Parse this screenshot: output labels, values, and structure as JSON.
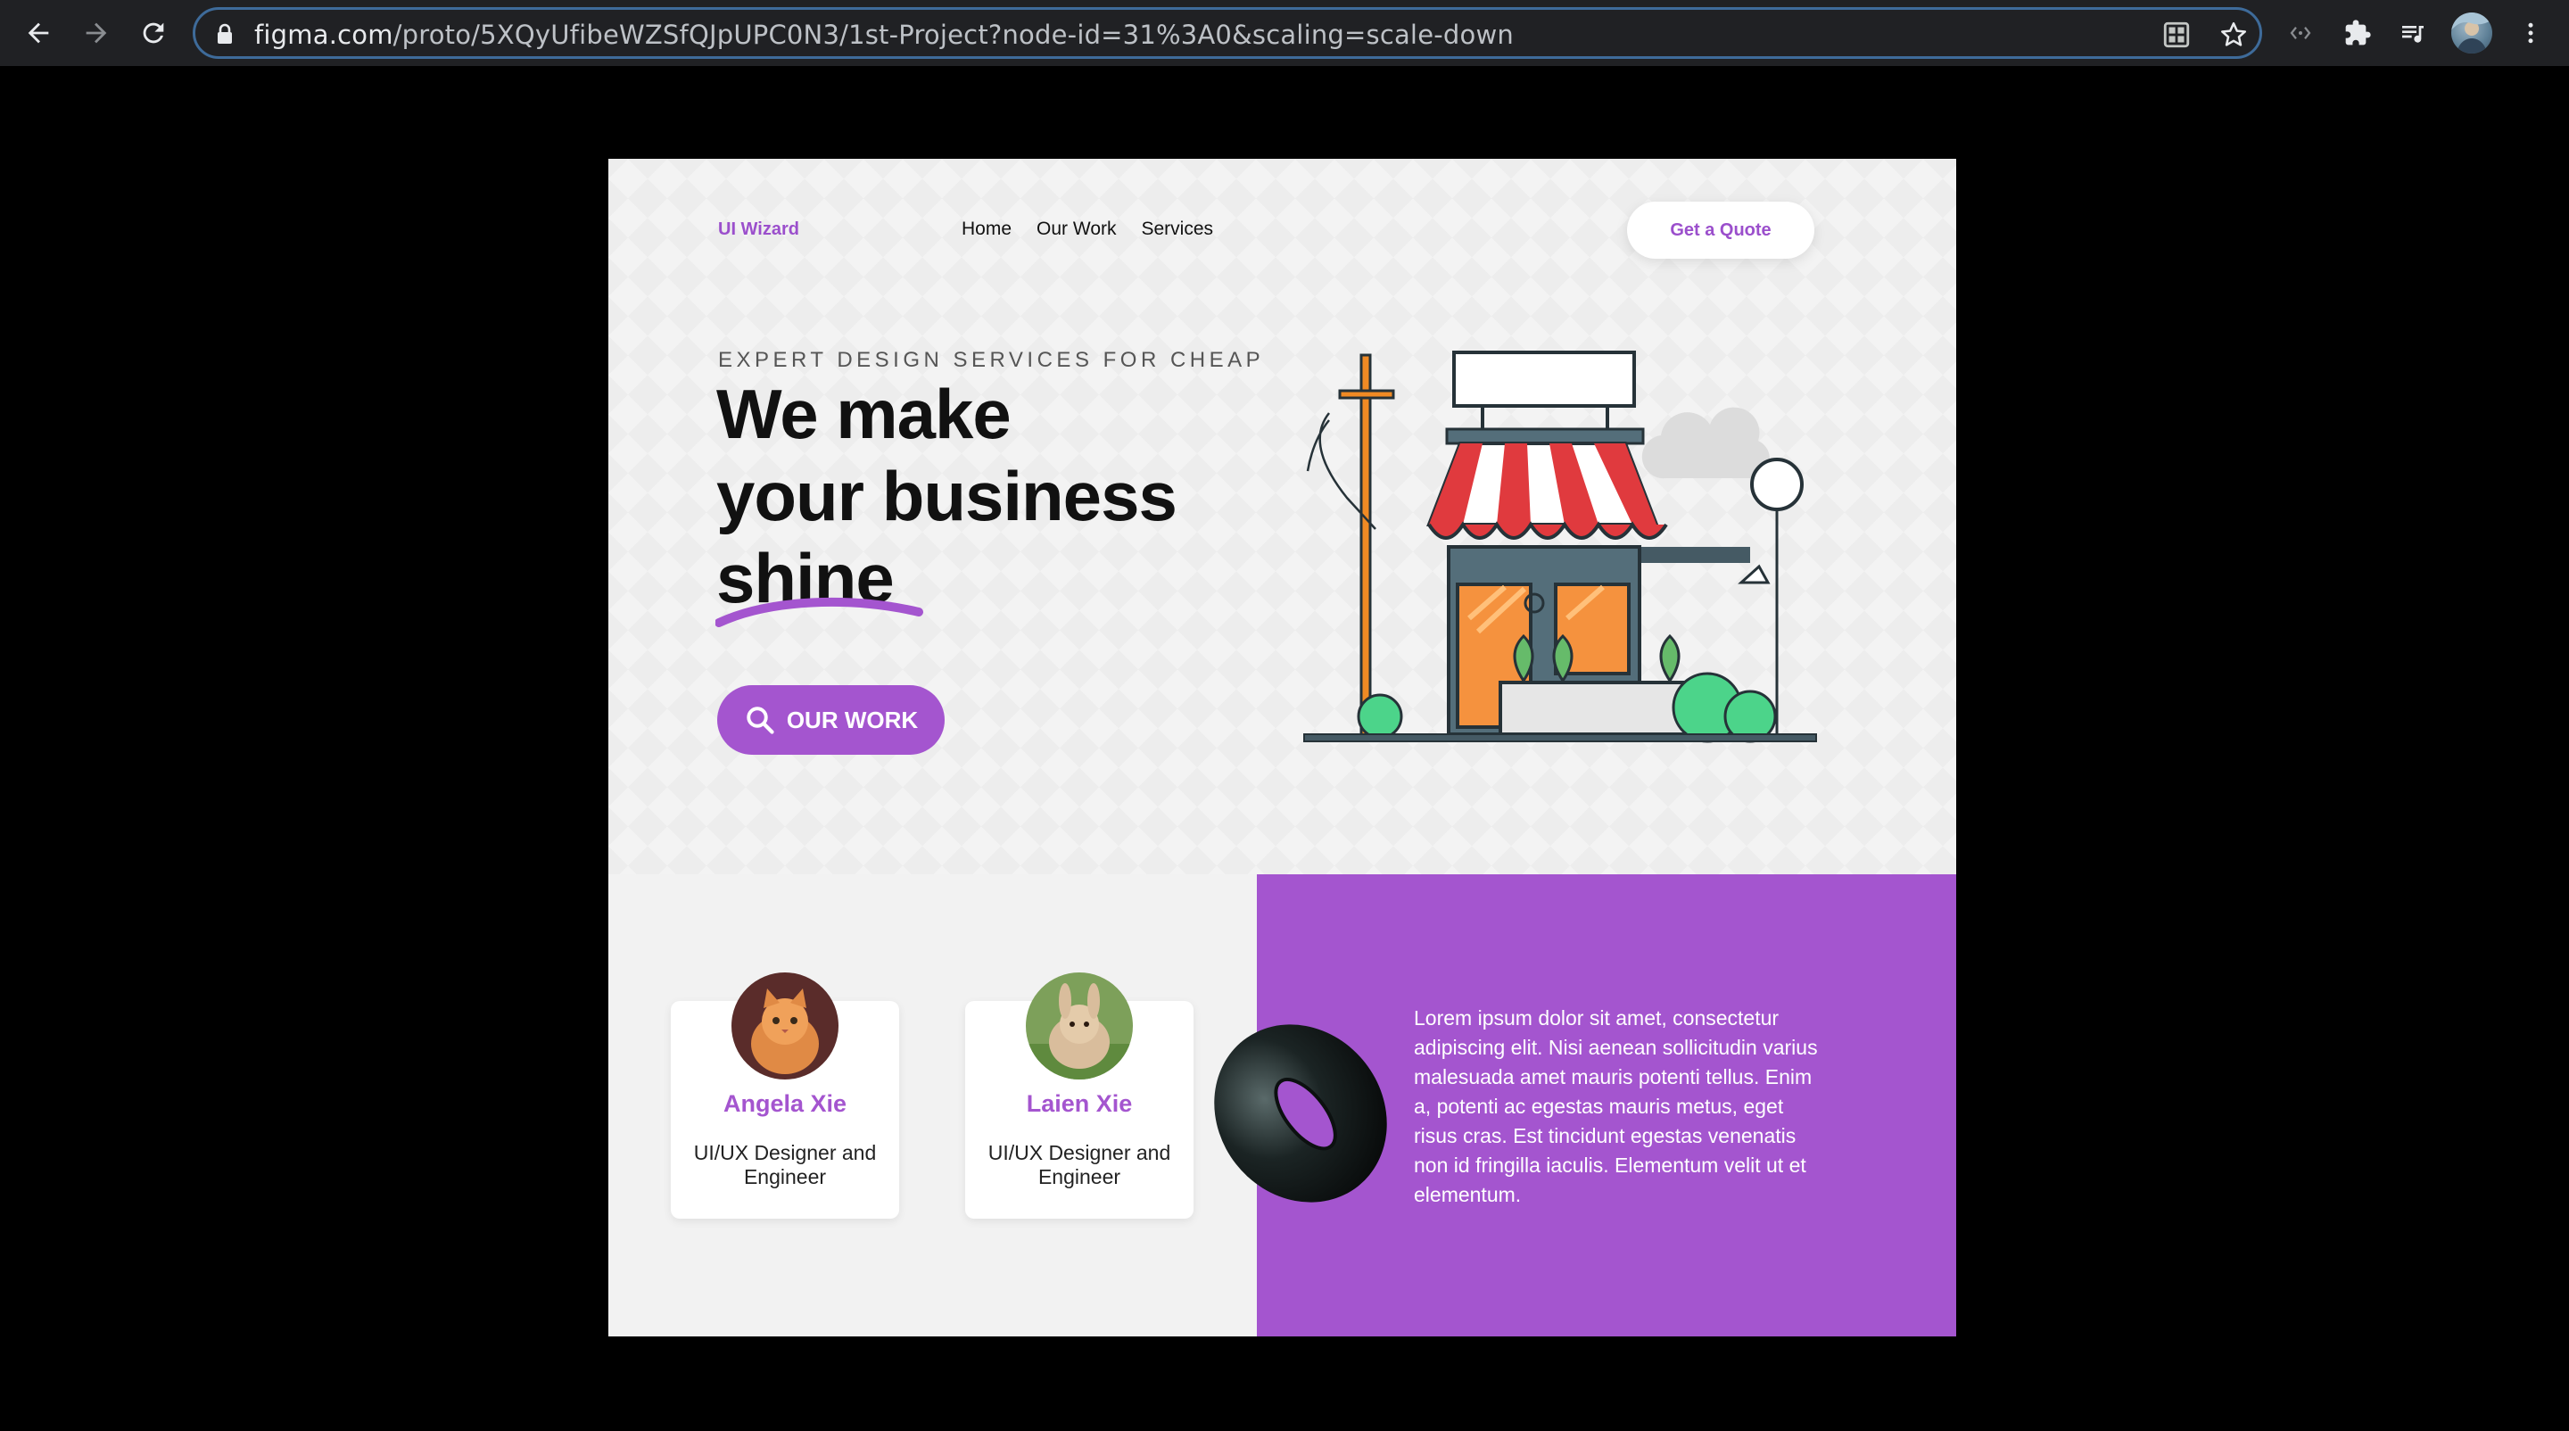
{
  "browser": {
    "url_host": "figma.com",
    "url_path": "/proto/5XQyUfibeWZSfQJpUPC0N3/1st-Project?node-id=31%3A0&scaling=scale-down",
    "icons": [
      "back-arrow-icon",
      "forward-arrow-icon",
      "reload-icon",
      "lock-icon",
      "qr-code-icon",
      "star-icon",
      "extension-icon",
      "puzzle-icon",
      "media-queue-icon",
      "profile-avatar",
      "kebab-menu-icon"
    ],
    "accent_border": "#3e6b9a"
  },
  "site": {
    "logo": "UI Wizard",
    "nav": [
      "Home",
      "Our Work",
      "Services"
    ],
    "cta": "Get a Quote",
    "eyebrow": "EXPERT DESIGN SERVICES FOR CHEAP",
    "headline": [
      "We make",
      "your business",
      "shine"
    ],
    "primary_button": "OUR WORK",
    "brand_color": "#a455cf"
  },
  "team": [
    {
      "name": "Angela Xie",
      "role": "UI/UX Designer and Engineer",
      "avatar": "cat-photo"
    },
    {
      "name": "Laien Xie",
      "role": "UI/UX Designer and Engineer",
      "avatar": "rabbit-photo"
    }
  ],
  "about_text": "Lorem ipsum dolor sit amet, consectetur adipiscing elit. Nisi aenean sollicitudin varius malesuada amet mauris potenti tellus. Enim a, potenti ac egestas mauris metus, eget risus cras. Est tincidunt egestas venenatis non id fringilla iaculis. Elementum velit ut et elementum."
}
